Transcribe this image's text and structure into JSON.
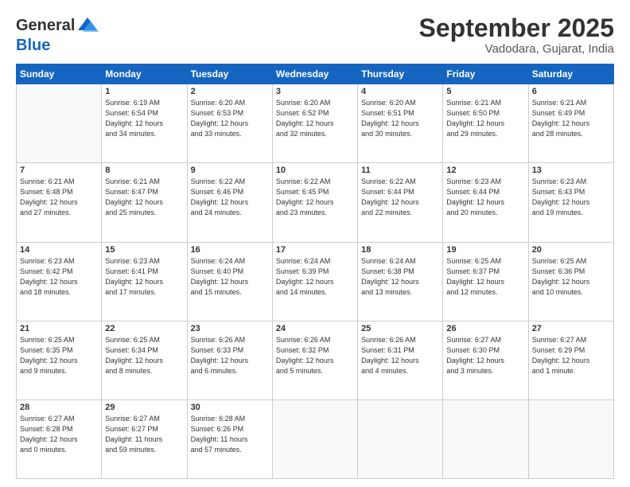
{
  "header": {
    "logo_general": "General",
    "logo_blue": "Blue",
    "title": "September 2025",
    "subtitle": "Vadodara, Gujarat, India"
  },
  "weekdays": [
    "Sunday",
    "Monday",
    "Tuesday",
    "Wednesday",
    "Thursday",
    "Friday",
    "Saturday"
  ],
  "weeks": [
    [
      {
        "day": "",
        "info": ""
      },
      {
        "day": "1",
        "info": "Sunrise: 6:19 AM\nSunset: 6:54 PM\nDaylight: 12 hours\nand 34 minutes."
      },
      {
        "day": "2",
        "info": "Sunrise: 6:20 AM\nSunset: 6:53 PM\nDaylight: 12 hours\nand 33 minutes."
      },
      {
        "day": "3",
        "info": "Sunrise: 6:20 AM\nSunset: 6:52 PM\nDaylight: 12 hours\nand 32 minutes."
      },
      {
        "day": "4",
        "info": "Sunrise: 6:20 AM\nSunset: 6:51 PM\nDaylight: 12 hours\nand 30 minutes."
      },
      {
        "day": "5",
        "info": "Sunrise: 6:21 AM\nSunset: 6:50 PM\nDaylight: 12 hours\nand 29 minutes."
      },
      {
        "day": "6",
        "info": "Sunrise: 6:21 AM\nSunset: 6:49 PM\nDaylight: 12 hours\nand 28 minutes."
      }
    ],
    [
      {
        "day": "7",
        "info": "Sunrise: 6:21 AM\nSunset: 6:48 PM\nDaylight: 12 hours\nand 27 minutes."
      },
      {
        "day": "8",
        "info": "Sunrise: 6:21 AM\nSunset: 6:47 PM\nDaylight: 12 hours\nand 25 minutes."
      },
      {
        "day": "9",
        "info": "Sunrise: 6:22 AM\nSunset: 6:46 PM\nDaylight: 12 hours\nand 24 minutes."
      },
      {
        "day": "10",
        "info": "Sunrise: 6:22 AM\nSunset: 6:45 PM\nDaylight: 12 hours\nand 23 minutes."
      },
      {
        "day": "11",
        "info": "Sunrise: 6:22 AM\nSunset: 6:44 PM\nDaylight: 12 hours\nand 22 minutes."
      },
      {
        "day": "12",
        "info": "Sunrise: 6:23 AM\nSunset: 6:44 PM\nDaylight: 12 hours\nand 20 minutes."
      },
      {
        "day": "13",
        "info": "Sunrise: 6:23 AM\nSunset: 6:43 PM\nDaylight: 12 hours\nand 19 minutes."
      }
    ],
    [
      {
        "day": "14",
        "info": "Sunrise: 6:23 AM\nSunset: 6:42 PM\nDaylight: 12 hours\nand 18 minutes."
      },
      {
        "day": "15",
        "info": "Sunrise: 6:23 AM\nSunset: 6:41 PM\nDaylight: 12 hours\nand 17 minutes."
      },
      {
        "day": "16",
        "info": "Sunrise: 6:24 AM\nSunset: 6:40 PM\nDaylight: 12 hours\nand 15 minutes."
      },
      {
        "day": "17",
        "info": "Sunrise: 6:24 AM\nSunset: 6:39 PM\nDaylight: 12 hours\nand 14 minutes."
      },
      {
        "day": "18",
        "info": "Sunrise: 6:24 AM\nSunset: 6:38 PM\nDaylight: 12 hours\nand 13 minutes."
      },
      {
        "day": "19",
        "info": "Sunrise: 6:25 AM\nSunset: 6:37 PM\nDaylight: 12 hours\nand 12 minutes."
      },
      {
        "day": "20",
        "info": "Sunrise: 6:25 AM\nSunset: 6:36 PM\nDaylight: 12 hours\nand 10 minutes."
      }
    ],
    [
      {
        "day": "21",
        "info": "Sunrise: 6:25 AM\nSunset: 6:35 PM\nDaylight: 12 hours\nand 9 minutes."
      },
      {
        "day": "22",
        "info": "Sunrise: 6:25 AM\nSunset: 6:34 PM\nDaylight: 12 hours\nand 8 minutes."
      },
      {
        "day": "23",
        "info": "Sunrise: 6:26 AM\nSunset: 6:33 PM\nDaylight: 12 hours\nand 6 minutes."
      },
      {
        "day": "24",
        "info": "Sunrise: 6:26 AM\nSunset: 6:32 PM\nDaylight: 12 hours\nand 5 minutes."
      },
      {
        "day": "25",
        "info": "Sunrise: 6:26 AM\nSunset: 6:31 PM\nDaylight: 12 hours\nand 4 minutes."
      },
      {
        "day": "26",
        "info": "Sunrise: 6:27 AM\nSunset: 6:30 PM\nDaylight: 12 hours\nand 3 minutes."
      },
      {
        "day": "27",
        "info": "Sunrise: 6:27 AM\nSunset: 6:29 PM\nDaylight: 12 hours\nand 1 minute."
      }
    ],
    [
      {
        "day": "28",
        "info": "Sunrise: 6:27 AM\nSunset: 6:28 PM\nDaylight: 12 hours\nand 0 minutes."
      },
      {
        "day": "29",
        "info": "Sunrise: 6:27 AM\nSunset: 6:27 PM\nDaylight: 11 hours\nand 59 minutes."
      },
      {
        "day": "30",
        "info": "Sunrise: 6:28 AM\nSunset: 6:26 PM\nDaylight: 11 hours\nand 57 minutes."
      },
      {
        "day": "",
        "info": ""
      },
      {
        "day": "",
        "info": ""
      },
      {
        "day": "",
        "info": ""
      },
      {
        "day": "",
        "info": ""
      }
    ]
  ]
}
